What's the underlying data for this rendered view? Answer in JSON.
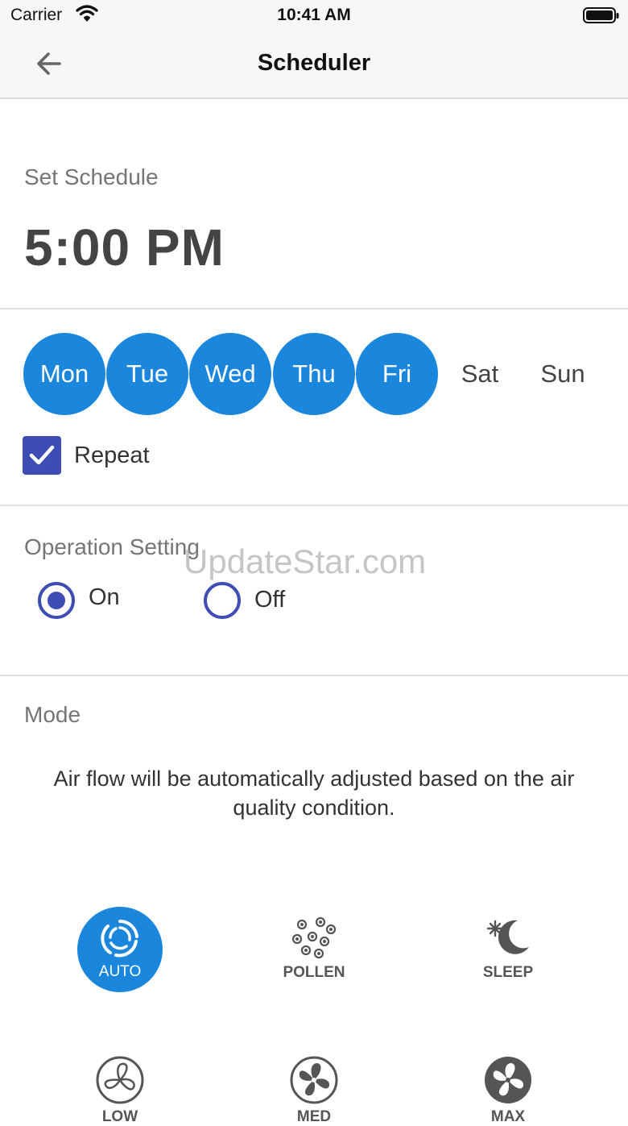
{
  "status_bar": {
    "carrier": "Carrier",
    "time": "10:41 AM"
  },
  "nav": {
    "title": "Scheduler"
  },
  "schedule": {
    "label": "Set Schedule",
    "time": "5:00 PM"
  },
  "days": [
    {
      "label": "Mon",
      "selected": true
    },
    {
      "label": "Tue",
      "selected": true
    },
    {
      "label": "Wed",
      "selected": true
    },
    {
      "label": "Thu",
      "selected": true
    },
    {
      "label": "Fri",
      "selected": true
    },
    {
      "label": "Sat",
      "selected": false
    },
    {
      "label": "Sun",
      "selected": false
    }
  ],
  "repeat": {
    "label": "Repeat",
    "checked": true
  },
  "operation": {
    "label": "Operation Setting",
    "options": [
      {
        "label": "On",
        "selected": true
      },
      {
        "label": "Off",
        "selected": false
      }
    ]
  },
  "mode": {
    "label": "Mode",
    "description": "Air flow will be automatically adjusted based on the air quality condition.",
    "buttons": [
      {
        "label": "AUTO",
        "icon": "auto-swirl-icon",
        "selected": true
      },
      {
        "label": "POLLEN",
        "icon": "pollen-icon",
        "selected": false
      },
      {
        "label": "SLEEP",
        "icon": "moon-sleep-icon",
        "selected": false
      },
      {
        "label": "LOW",
        "icon": "fan-low-icon",
        "selected": false
      },
      {
        "label": "MED",
        "icon": "fan-med-icon",
        "selected": false
      },
      {
        "label": "MAX",
        "icon": "fan-max-icon",
        "selected": false
      }
    ]
  },
  "watermark": "UpdateStar.com",
  "colors": {
    "accent": "#1a87dd",
    "checkbox": "#3d4db4",
    "radio": "#3d4db4"
  }
}
